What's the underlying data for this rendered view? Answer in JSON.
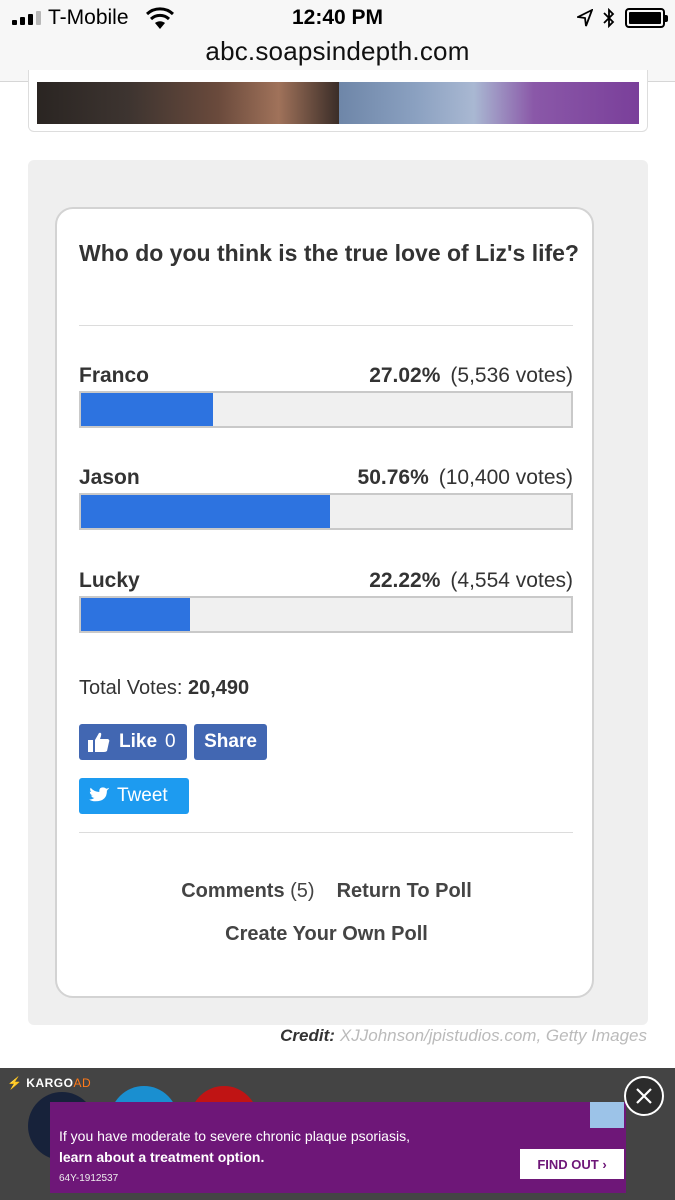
{
  "status_bar": {
    "carrier": "T-Mobile",
    "time": "12:40 PM"
  },
  "browser": {
    "url": "abc.soapsindepth.com"
  },
  "poll": {
    "question": "Who do you think is the true love of Liz's life?",
    "options": [
      {
        "label": "Franco",
        "percent": "27.02%",
        "votes": "(5,536 votes)",
        "fraction": 0.2702
      },
      {
        "label": "Jason",
        "percent": "50.76%",
        "votes": "(10,400 votes)",
        "fraction": 0.5076
      },
      {
        "label": "Lucky",
        "percent": "22.22%",
        "votes": "(4,554 votes)",
        "fraction": 0.2222
      }
    ],
    "total_label": "Total Votes:",
    "total_value": "20,490",
    "bar_color": "#2d73e0"
  },
  "social": {
    "like_label": "Like",
    "like_count": "0",
    "share_label": "Share",
    "tweet_label": "Tweet"
  },
  "links": {
    "comments_label": "Comments",
    "comments_count": "(5)",
    "return_label": "Return To Poll",
    "create_label": "Create Your Own Poll"
  },
  "credit": {
    "label": "Credit:",
    "text": "XJJohnson/jpistudios.com, Getty Images"
  },
  "ad": {
    "network": "KARGO",
    "network_tag": "AD",
    "line1": "If you have moderate to severe chronic plaque psoriasis,",
    "line2": "learn about a treatment option.",
    "code": "64Y-1912537",
    "cta": "FIND OUT ›"
  }
}
